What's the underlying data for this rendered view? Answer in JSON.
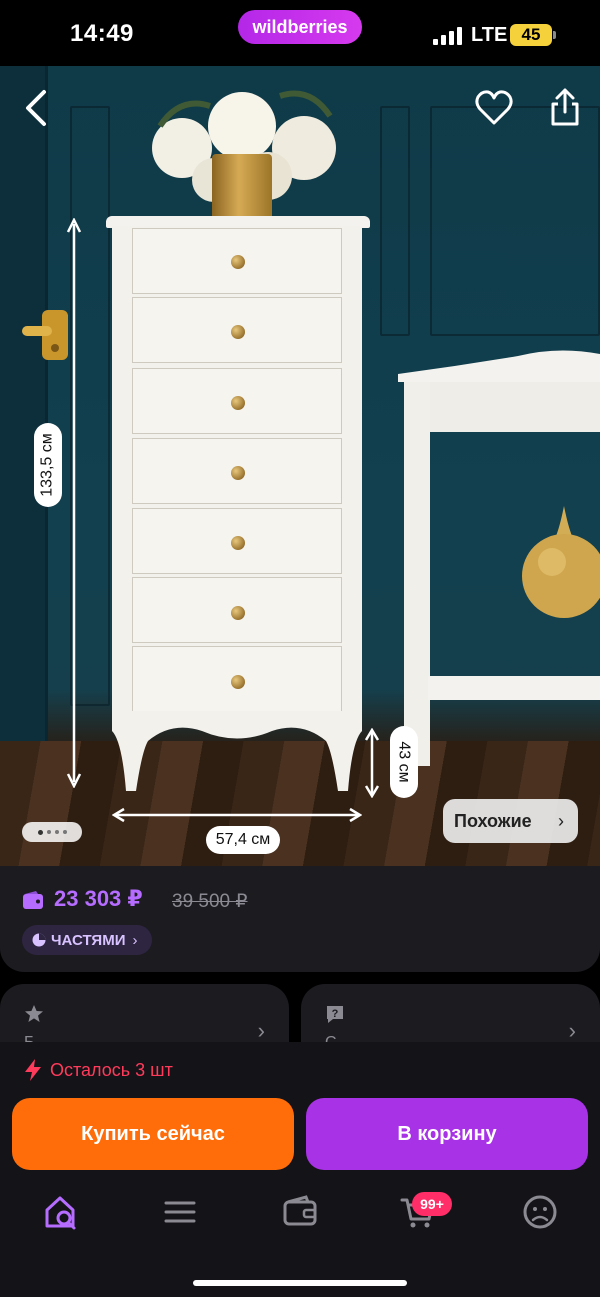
{
  "status_bar": {
    "time": "14:49",
    "brand": "wildberries",
    "network": "LTE",
    "battery": "45"
  },
  "product_image": {
    "height_label": "133,5 см",
    "width_label": "57,4 см",
    "depth_label": "43 см",
    "similar_label": "Похожие",
    "pager": {
      "total": 4,
      "active": 0
    },
    "icons": [
      "back-arrow-icon",
      "heart-icon",
      "share-icon"
    ]
  },
  "price": {
    "current": "23 303 ₽",
    "old": "39 500 ₽",
    "installments_label": "ЧАСТЯМИ",
    "accent_color": "#b66dff"
  },
  "info_cards": [
    {
      "icon": "star-icon",
      "peek_text": "Б"
    },
    {
      "icon": "question-icon",
      "peek_text": "С"
    }
  ],
  "stock": {
    "label": "Осталось 3 шт",
    "color": "#ff3b5c"
  },
  "actions": {
    "buy_now": "Купить сейчас",
    "buy_now_color": "#ff6d0a",
    "add_to_cart": "В корзину",
    "add_to_cart_color": "#a732e6"
  },
  "tabbar": {
    "items": [
      "home-search-icon",
      "catalog-menu-icon",
      "wallet-icon",
      "cart-icon",
      "profile-icon"
    ],
    "active": 0,
    "cart_badge": "99+"
  }
}
